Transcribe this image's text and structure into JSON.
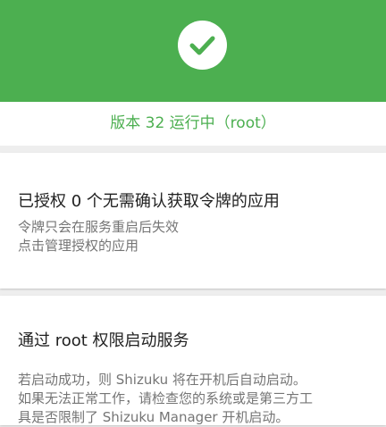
{
  "status": {
    "icon": "check-icon",
    "text": "版本 32 运行中（root）",
    "accent_color": "#4caf50"
  },
  "authorized_card": {
    "title": "已授权 0 个无需确认获取令牌的应用",
    "lines": [
      "令牌只会在服务重启后失效",
      "点击管理授权的应用"
    ]
  },
  "root_card": {
    "title": "通过 root 权限启动服务",
    "lines": [
      "若启动成功，则 Shizuku 将在开机后自动启动。",
      "如果无法正常工作，请检查您的系统或是第三方工",
      "具是否限制了 Shizuku Manager 开机启动。"
    ]
  }
}
